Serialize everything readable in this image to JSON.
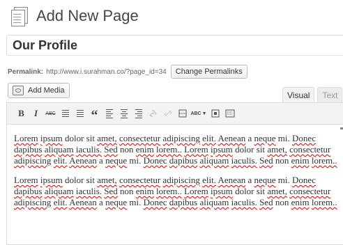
{
  "header": {
    "title": "Add New Page",
    "icon": "page-icon"
  },
  "title_field": {
    "value": "Our Profile"
  },
  "permalink": {
    "label": "Permalink:",
    "url": "http://www.i.surahman.co/?page_id=34",
    "change_button": "Change Permalinks"
  },
  "media": {
    "add_button": "Add Media"
  },
  "tabs": [
    {
      "label": "Visual",
      "active": true
    },
    {
      "label": "Text",
      "active": false
    }
  ],
  "toolbar": {
    "buttons": [
      "bold",
      "italic",
      "strikethrough",
      "bulleted-list",
      "numbered-list",
      "blockquote",
      "align-left",
      "align-center",
      "align-right",
      "insert-link",
      "remove-link",
      "insert-more",
      "spellcheck",
      "fullscreen",
      "kitchen-sink"
    ],
    "bold_label": "B",
    "italic_label": "I",
    "strike_label": "ABC",
    "quote_label": "“",
    "spell_label": "ABC"
  },
  "content": {
    "paragraphs": [
      "Lorem ipsum dolor sit amet, consectetur adipiscing elit. Aenean a neque mi. Donec dapibus aliquam iaculis. Sed non enim lorem.. Lorem ipsum dolor sit amet, consectetur adipiscing elit. Aenean a neque mi. Donec dapibus aliquam iaculis. Sed non enim lorem..",
      "Lorem ipsum dolor sit amet, consectetur adipiscing elit. Aenean a neque mi. Donec dapibus aliquam iaculis. Sed non enim lorem.. Lorem ipsum dolor sit amet, consectetur adipiscing elit. Aenean a neque mi. Donec dapibus aliquam iaculis. Sed non enim lorem.."
    ],
    "misspelled": [
      "Lorem",
      "ipsum",
      "amet,",
      "consectetur",
      "adipiscing",
      "elit.",
      "Aenean",
      "neque",
      "Donec",
      "dapibus",
      "aliquam",
      "iaculis.",
      "Sed",
      "enim",
      "lorem..",
      "lorem"
    ]
  },
  "colors": {
    "accent": "#21759b",
    "spell_error": "#dd0000",
    "toolbar_bg": "#f3f3f3"
  }
}
